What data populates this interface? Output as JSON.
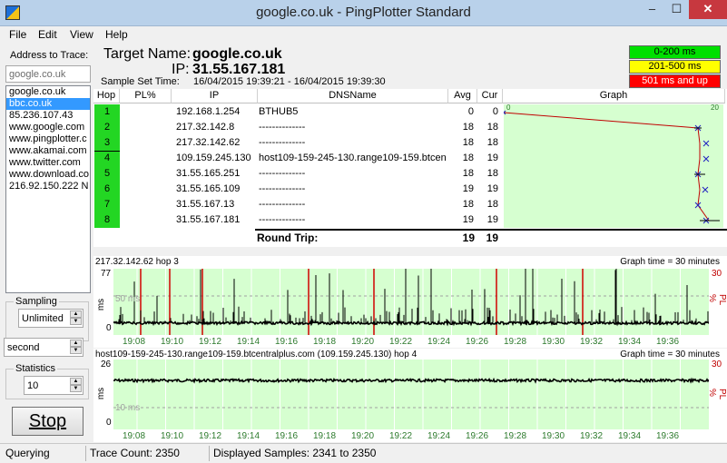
{
  "window": {
    "title": "google.co.uk - PingPlotter Standard",
    "minimize_label": "–",
    "maximize_label": "☐",
    "close_label": "✕"
  },
  "menu": [
    "File",
    "Edit",
    "View",
    "Help"
  ],
  "left": {
    "address_label": "Address to Trace:",
    "address_value": "google.co.uk",
    "addresses": [
      "google.co.uk",
      "bbc.co.uk",
      "85.236.107.43",
      "www.google.com",
      "www.pingplotter.c",
      "www.akamai.com",
      "www.twitter.com",
      "www.download.co",
      "216.92.150.222 N"
    ],
    "selected_index": 1,
    "sampling_label": "Sampling",
    "sampling_value": "Unlimited",
    "interval_value": "second",
    "statistics_label": "Statistics",
    "statistics_value": "10",
    "stop_label": "Stop"
  },
  "header": {
    "target_label": "Target Name:",
    "target_value": "google.co.uk",
    "ip_label": "IP:",
    "ip_value": "31.55.167.181",
    "sample_label": "Sample Set Time:",
    "sample_value": "16/04/2015 19:39:21 - 16/04/2015 19:39:30",
    "legend": [
      {
        "label": "0-200 ms",
        "color": "#00e000"
      },
      {
        "label": "201-500 ms",
        "color": "#ffff00"
      },
      {
        "label": "501 ms and up",
        "color": "#ff0000"
      }
    ]
  },
  "trace": {
    "columns": {
      "hop": "Hop",
      "pl": "PL%",
      "ip": "IP",
      "dns": "DNSName",
      "avg": "Avg",
      "cur": "Cur",
      "graph": "Graph"
    },
    "rows": [
      {
        "hop": "1",
        "pl": "",
        "ip": "192.168.1.254",
        "dns": "BTHUB5",
        "avg": "0",
        "cur": "0"
      },
      {
        "hop": "2",
        "pl": "",
        "ip": "217.32.142.8",
        "dns": "--------------",
        "avg": "18",
        "cur": "18"
      },
      {
        "hop": "3",
        "pl": "",
        "ip": "217.32.142.62",
        "dns": "--------------",
        "avg": "18",
        "cur": "18"
      },
      {
        "hop": "4",
        "pl": "",
        "ip": "109.159.245.130",
        "dns": "host109-159-245-130.range109-159.btcen",
        "avg": "18",
        "cur": "19"
      },
      {
        "hop": "5",
        "pl": "",
        "ip": "31.55.165.251",
        "dns": "--------------",
        "avg": "18",
        "cur": "18"
      },
      {
        "hop": "6",
        "pl": "",
        "ip": "31.55.165.109",
        "dns": "--------------",
        "avg": "19",
        "cur": "19"
      },
      {
        "hop": "7",
        "pl": "",
        "ip": "31.55.167.13",
        "dns": "--------------",
        "avg": "18",
        "cur": "18"
      },
      {
        "hop": "8",
        "pl": "",
        "ip": "31.55.167.181",
        "dns": "--------------",
        "avg": "19",
        "cur": "19"
      }
    ],
    "graph_scale_min": "0",
    "graph_scale_max": "20",
    "round_trip_label": "Round Trip:",
    "round_trip_avg": "19",
    "round_trip_cur": "19"
  },
  "graphs": [
    {
      "title": "217.32.142.62 hop 3",
      "graph_time": "Graph time = 30 minutes",
      "y_max": "77",
      "y_min": "0",
      "y_unit": "ms",
      "guide_label": "50 ms",
      "pl_max": "30",
      "pl_unit": "PL %",
      "x_ticks": [
        "19:08",
        "19:10",
        "19:12",
        "19:14",
        "19:16",
        "19:18",
        "19:20",
        "19:22",
        "19:24",
        "19:26",
        "19:28",
        "19:30",
        "19:32",
        "19:34",
        "19:36"
      ]
    },
    {
      "title": "host109-159-245-130.range109-159.btcentralplus.com (109.159.245.130) hop 4",
      "graph_time": "Graph time = 30 minutes",
      "y_max": "26",
      "y_min": "0",
      "y_unit": "ms",
      "guide_label": "10 ms",
      "pl_max": "30",
      "pl_unit": "PL %",
      "x_ticks": [
        "19:08",
        "19:10",
        "19:12",
        "19:14",
        "19:16",
        "19:18",
        "19:20",
        "19:22",
        "19:24",
        "19:26",
        "19:28",
        "19:30",
        "19:32",
        "19:34",
        "19:36"
      ]
    }
  ],
  "status": {
    "state": "Querying",
    "trace_count": "Trace Count: 2350",
    "displayed": "Displayed Samples: 2341 to 2350"
  }
}
